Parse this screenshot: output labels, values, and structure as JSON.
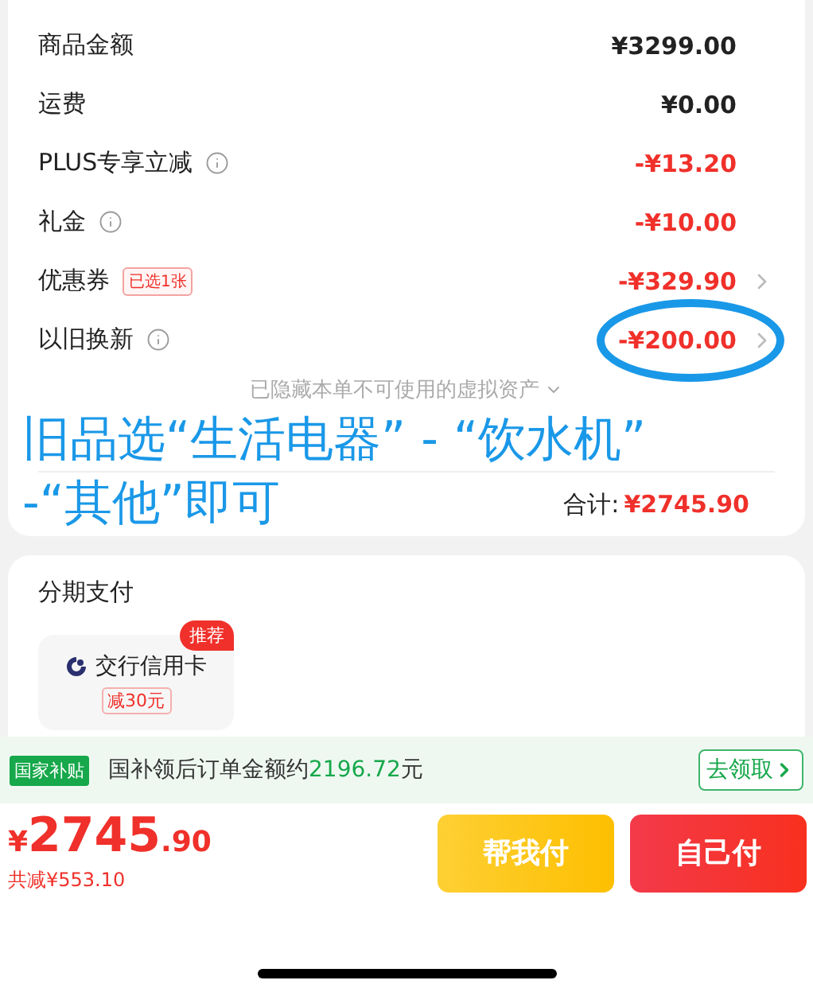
{
  "price_rows": [
    {
      "label": "商品金额",
      "amount": "¥3299.00",
      "kind": "plain",
      "info": false,
      "chevron": false
    },
    {
      "label": "运费",
      "amount": "¥0.00",
      "kind": "plain",
      "info": false,
      "chevron": false
    },
    {
      "label": "PLUS专享立减",
      "amount": "-¥13.20",
      "kind": "discount",
      "info": true,
      "chevron": false
    },
    {
      "label": "礼金",
      "amount": "-¥10.00",
      "kind": "discount",
      "info": true,
      "chevron": false
    },
    {
      "label": "优惠券",
      "tag": "已选1张",
      "amount": "-¥329.90",
      "kind": "discount",
      "info": false,
      "chevron": true
    },
    {
      "label": "以旧换新",
      "amount": "-¥200.00",
      "kind": "discount",
      "info": true,
      "chevron": true,
      "circled": true
    }
  ],
  "hidden_assets": "已隐藏本单不可使用的虚拟资产",
  "total": {
    "label": "合计:",
    "amount": "¥2745.90"
  },
  "annotation": [
    "旧品选“生活电器” - “饮水机”",
    "-“其他”即可"
  ],
  "installment": {
    "title": "分期支付",
    "options": [
      {
        "bank": "交行信用卡",
        "promo": "减30元",
        "badge": "推荐"
      }
    ]
  },
  "subsidy": {
    "badge": "国家补贴",
    "text": "国补领后订单金额约",
    "amount": "2196.72",
    "unit": "元",
    "button": "去领取"
  },
  "checkout": {
    "currency": "¥",
    "integer": "2745",
    "decimal": ".90",
    "savings": "共减¥553.10",
    "buttons": [
      {
        "label": "帮我付",
        "kind": "secondary"
      },
      {
        "label": "自己付",
        "kind": "primary"
      }
    ]
  }
}
